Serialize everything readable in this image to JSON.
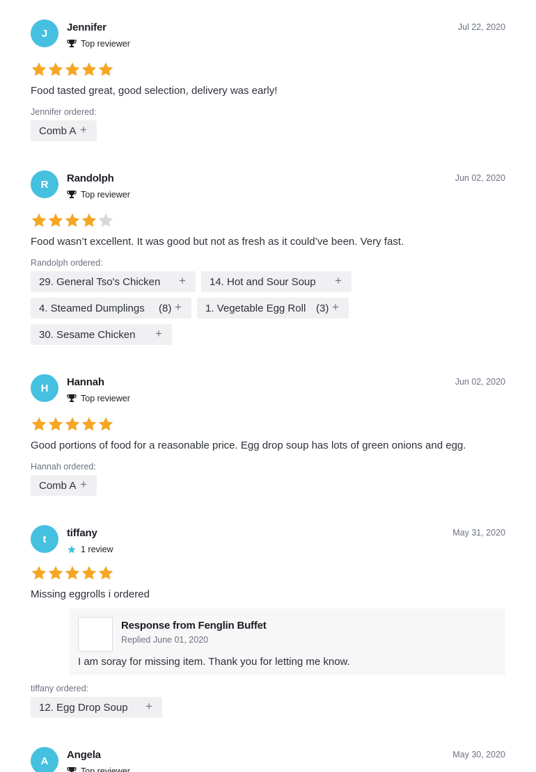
{
  "reviews": [
    {
      "initial": "J",
      "name": "Jennifer",
      "badge": "Top reviewer",
      "badge_icon": "trophy-icon",
      "date": "Jul 22, 2020",
      "rating": 5,
      "text": "Food tasted great, good selection, delivery was early!",
      "ordered_label": "Jennifer ordered:",
      "items": [
        {
          "name": "Comb A",
          "qty": ""
        }
      ]
    },
    {
      "initial": "R",
      "name": "Randolph",
      "badge": "Top reviewer",
      "badge_icon": "trophy-icon",
      "date": "Jun 02, 2020",
      "rating": 4,
      "text": "Food wasn’t excellent. It was good but not as fresh as it could’ve been. Very fast.",
      "ordered_label": "Randolph ordered:",
      "items": [
        {
          "name": "29. General Tso's Chicken",
          "qty": ""
        },
        {
          "name": "14. Hot and Sour Soup",
          "qty": ""
        },
        {
          "name": "4. Steamed Dumplings",
          "qty": "(8)"
        },
        {
          "name": "1. Vegetable Egg Roll",
          "qty": "(3)"
        },
        {
          "name": "30. Sesame Chicken",
          "qty": ""
        }
      ]
    },
    {
      "initial": "H",
      "name": "Hannah",
      "badge": "Top reviewer",
      "badge_icon": "trophy-icon",
      "date": "Jun 02, 2020",
      "rating": 5,
      "text": "Good portions of food for a reasonable price. Egg drop soup has lots of green onions and egg.",
      "ordered_label": "Hannah ordered:",
      "items": [
        {
          "name": "Comb A",
          "qty": ""
        }
      ]
    },
    {
      "initial": "t",
      "name": "tiffany",
      "badge": "1 review",
      "badge_icon": "star-icon",
      "date": "May 31, 2020",
      "rating": 5,
      "text": "Missing eggrolls i ordered",
      "response": {
        "title": "Response from Fenglin Buffet",
        "date": "Replied June 01, 2020",
        "text": "I am soray for missing item. Thank you for letting me know."
      },
      "ordered_label": "tiffany ordered:",
      "items": [
        {
          "name": "12. Egg Drop Soup",
          "qty": ""
        }
      ]
    },
    {
      "initial": "A",
      "name": "Angela",
      "badge": "Top reviewer",
      "badge_icon": "trophy-icon",
      "date": "May 30, 2020"
    }
  ],
  "plus_symbol": "+",
  "colors": {
    "avatar": "#45c0df",
    "star_filled": "#f5a623",
    "star_empty": "#d8d8d8",
    "chip_bg": "#f0f0f2"
  }
}
